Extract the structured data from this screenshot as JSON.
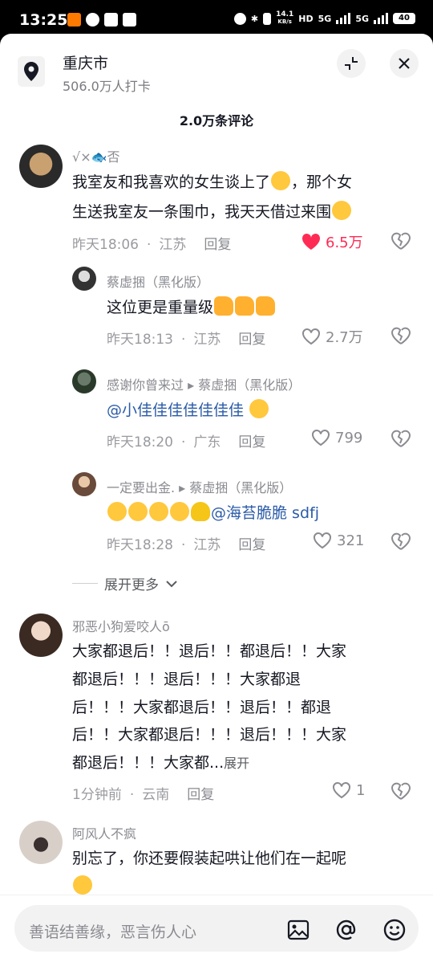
{
  "status": {
    "time": "13:25",
    "net_speed": "14.1",
    "net_unit": "KB/s",
    "hd": "HD",
    "sig1": "5G",
    "sig2": "5G",
    "battery": "40"
  },
  "header": {
    "title": "重庆市",
    "subtitle": "506.0万人打卡"
  },
  "comment_count": "2.0万条评论",
  "comments": [
    {
      "user": "√×🐟否",
      "line1": "我室友和我喜欢的女生谈上了",
      "line1b": "，那个女",
      "line2": "生送我室友一条围巾，我天天借过来围",
      "time": "昨天18:06",
      "region": "江苏",
      "reply": "回复",
      "likes": "6.5万"
    },
    {
      "user": "蔡虚捆（黑化版）",
      "text": "这位更是重量级",
      "time": "昨天18:13",
      "region": "江苏",
      "reply": "回复",
      "likes": "2.7万"
    },
    {
      "user": "感谢你曾来过 ▸ 蔡虚捆（黑化版）",
      "text": "@小佳佳佳佳佳佳佳",
      "time": "昨天18:20",
      "region": "广东",
      "reply": "回复",
      "likes": "799"
    },
    {
      "user": "一定要出金. ▸ 蔡虚捆（黑化版）",
      "text_mention": "@海苔脆脆",
      "text_tail": " sdfj",
      "time": "昨天18:28",
      "region": "江苏",
      "reply": "回复",
      "likes": "321"
    },
    {
      "user": "邪恶小狗爱咬人ō",
      "lines": [
        "大家都退后！！退后！！都退后！！大家",
        "都退后！！！退后！！！大家都退",
        "后！！！大家都退后！！退后！！都退",
        "后！！大家都退后！！！退后！！！大家"
      ],
      "last": "都退后！！！大家都...",
      "expand": "展开",
      "time": "1分钟前",
      "region": "云南",
      "reply": "回复",
      "likes": "1"
    },
    {
      "user": "阿风人不疯",
      "text": "别忘了，你还要假装起哄让他们在一起呢"
    }
  ],
  "more_replies": "展开更多",
  "input": {
    "placeholder": "善语结善缘，恶言伤人心"
  },
  "colors": {
    "accent": "#fe2c55",
    "mention": "#2b5ba8"
  }
}
